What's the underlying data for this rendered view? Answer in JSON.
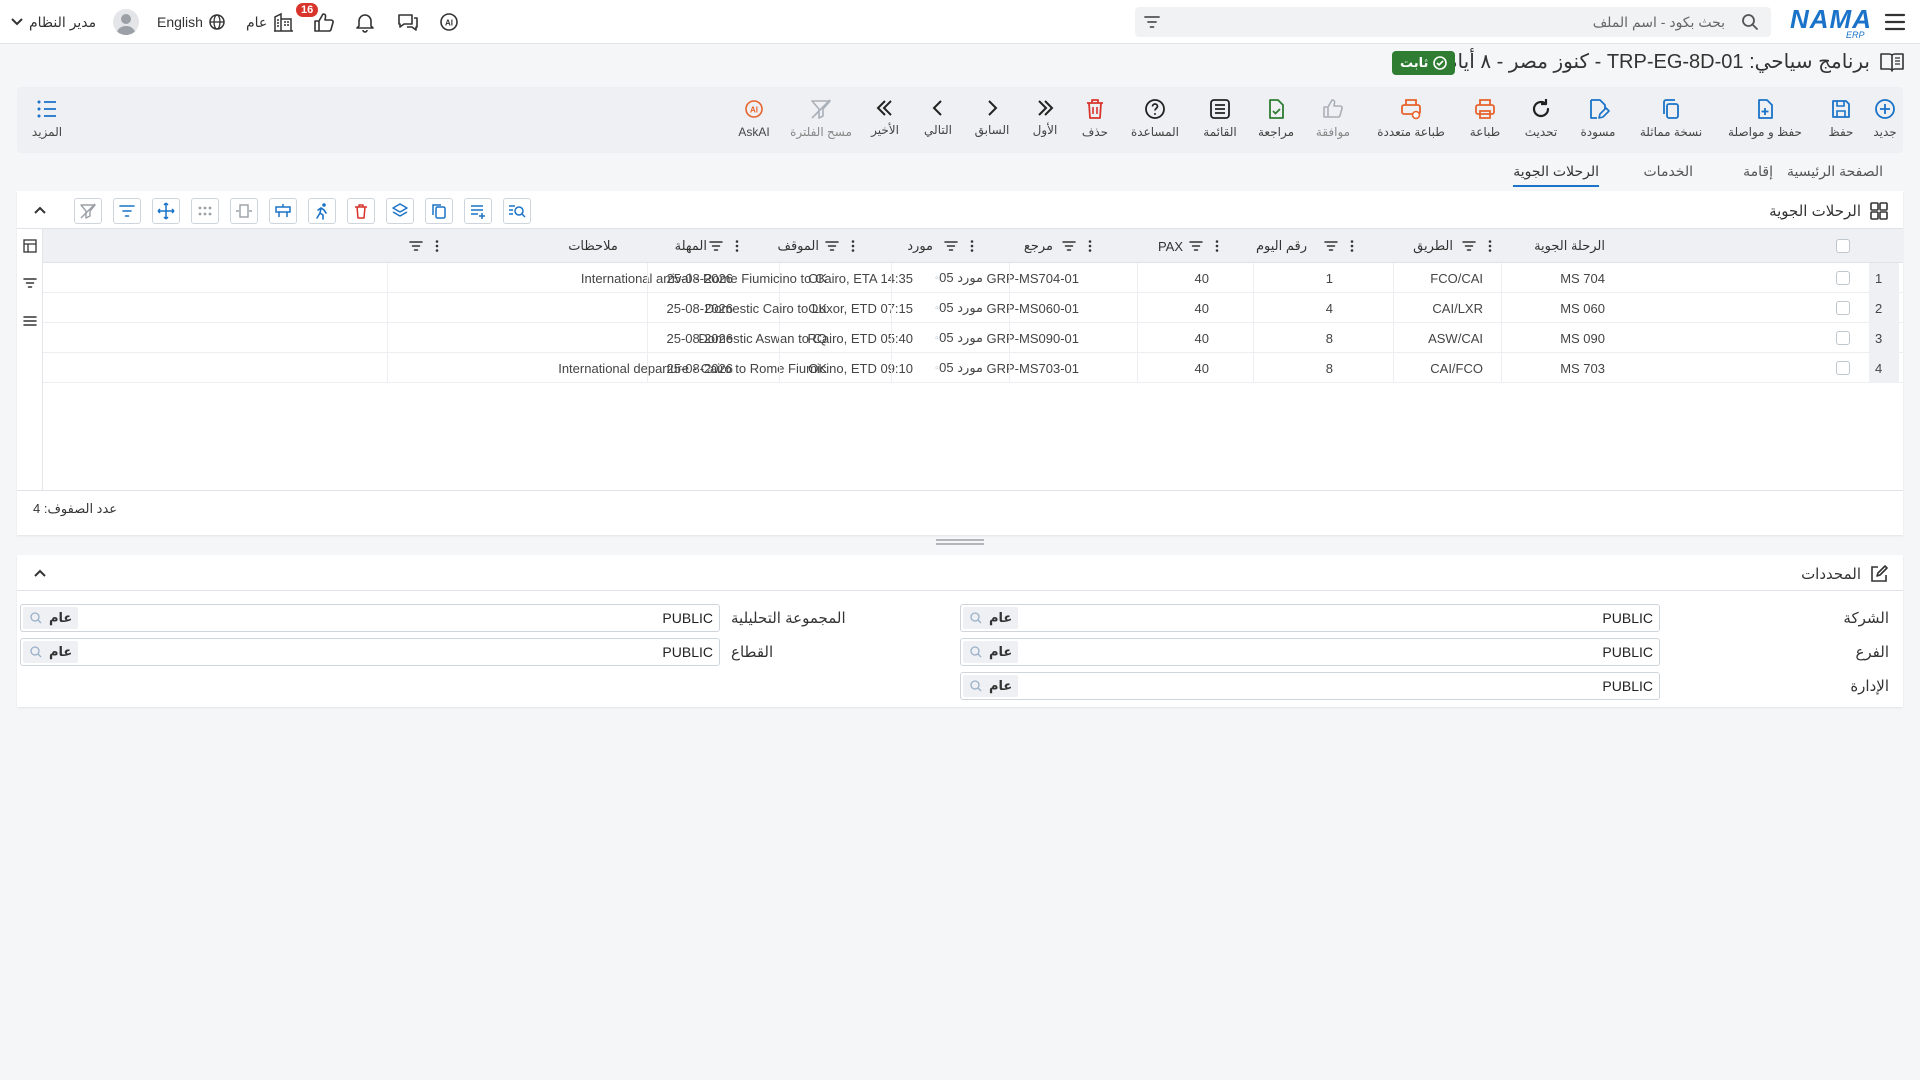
{
  "topbar": {
    "search_placeholder": "بحث بكود - اسم الملف",
    "language": "English",
    "scope": "عام",
    "notification_count": "16",
    "user": "مدير النظام",
    "logo_text": "NAMA",
    "logo_sub": "ERP"
  },
  "page": {
    "title": "برنامج سياحي: TRP-EG-8D-01 - كنوز مصر - ٨ أيام",
    "status": "ثابت"
  },
  "toolbar": {
    "new": "جديد",
    "save": "حفظ",
    "save_continue": "حفظ و مواصلة",
    "copy": "نسخة مماثلة",
    "draft": "مسودة",
    "refresh": "تحديث",
    "print": "طباعة",
    "multi_print": "طباعة متعددة",
    "approve": "موافقة",
    "review": "مراجعة",
    "list": "القائمة",
    "help": "المساعدة",
    "delete": "حذف",
    "first": "الأول",
    "previous": "السابق",
    "next": "التالي",
    "last": "الأخير",
    "clear_filter": "مسح الفلترة",
    "askai": "AskAI",
    "more": "المزيد"
  },
  "tabs": [
    "الصفحة الرئيسية",
    "إقامة",
    "الخدمات",
    "الرحلات الجوية"
  ],
  "flights": {
    "title": "الرحلات الجوية",
    "columns": {
      "flight": "الرحلة الجوية",
      "route": "الطريق",
      "day": "رقم اليوم",
      "pax": "PAX",
      "ref": "مرجع",
      "supplier": "مورد",
      "status": "الموقف",
      "deadline": "المهلة",
      "notes": "ملاحظات"
    },
    "rows": [
      {
        "n": "1",
        "flight": "MS 704",
        "route": "FCO/CAI",
        "day": "1",
        "pax": "40",
        "ref": "GRP-MS704-01",
        "supplier": "مورد 05",
        "status": "OK",
        "deadline": "25-08-2026",
        "notes": "International arrival - Rome Fiumicino to Cairo, ETA 14:35"
      },
      {
        "n": "2",
        "flight": "MS 060",
        "route": "CAI/LXR",
        "day": "4",
        "pax": "40",
        "ref": "GRP-MS060-01",
        "supplier": "مورد 05",
        "status": "OK",
        "deadline": "25-08-2026",
        "notes": "Domestic Cairo to Luxor, ETD 07:15"
      },
      {
        "n": "3",
        "flight": "MS 090",
        "route": "ASW/CAI",
        "day": "8",
        "pax": "40",
        "ref": "GRP-MS090-01",
        "supplier": "مورد 05",
        "status": "RQ",
        "deadline": "25-08-2026",
        "notes": "Domestic Aswan to Cairo, ETD 05:40"
      },
      {
        "n": "4",
        "flight": "MS 703",
        "route": "CAI/FCO",
        "day": "8",
        "pax": "40",
        "ref": "GRP-MS703-01",
        "supplier": "مورد 05",
        "status": "OK",
        "deadline": "25-08-2026",
        "notes": "International departure - Cairo to Rome Fiumicino, ETD 09:10"
      }
    ],
    "row_count": "عدد الصفوف: 4"
  },
  "limits": {
    "title": "المحددات",
    "company_label": "الشركة",
    "company_value": "PUBLIC",
    "company_tag": "عام",
    "branch_label": "الفرع",
    "branch_value": "PUBLIC",
    "branch_tag": "عام",
    "dept_label": "الإدارة",
    "dept_value": "PUBLIC",
    "dept_tag": "عام",
    "agroup_label": "المجموعة التحليلية",
    "agroup_value": "PUBLIC",
    "agroup_tag": "عام",
    "sector_label": "القطاع",
    "sector_value": "PUBLIC",
    "sector_tag": "عام"
  },
  "colors": {
    "primary": "#1a73c8",
    "danger": "#d9342b",
    "success": "#2e7d32",
    "print": "#e8622c"
  }
}
